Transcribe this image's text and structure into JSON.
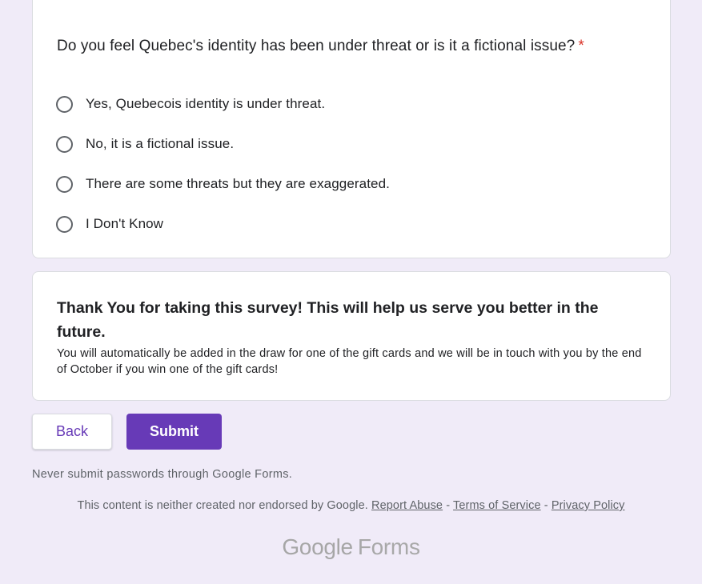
{
  "question": {
    "title": "Do you feel Quebec's identity has been under threat or is it a fictional issue?",
    "required_marker": "*",
    "options": [
      {
        "label": "Yes, Quebecois identity is under threat."
      },
      {
        "label": "No, it is a fictional issue."
      },
      {
        "label": "There are some threats but they are exaggerated."
      },
      {
        "label": "I Don't Know"
      }
    ]
  },
  "thanks": {
    "title": "Thank You for taking this survey! This will help us serve you better in the future.",
    "body": "You will automatically be added in the draw for one of the gift cards and we will be in touch with you by the end of October if you win one of the gift cards!"
  },
  "buttons": {
    "back": "Back",
    "submit": "Submit"
  },
  "footer": {
    "warning": "Never submit passwords through Google Forms.",
    "disclaimer": "This content is neither created nor endorsed by Google.",
    "report_abuse": "Report Abuse",
    "separator": "-",
    "terms": "Terms of Service",
    "privacy": "Privacy Policy",
    "logo_word_1": "Google",
    "logo_word_2": "Forms"
  },
  "colors": {
    "background": "#f0ebf8",
    "accent": "#673ab7",
    "required": "#d93025"
  }
}
